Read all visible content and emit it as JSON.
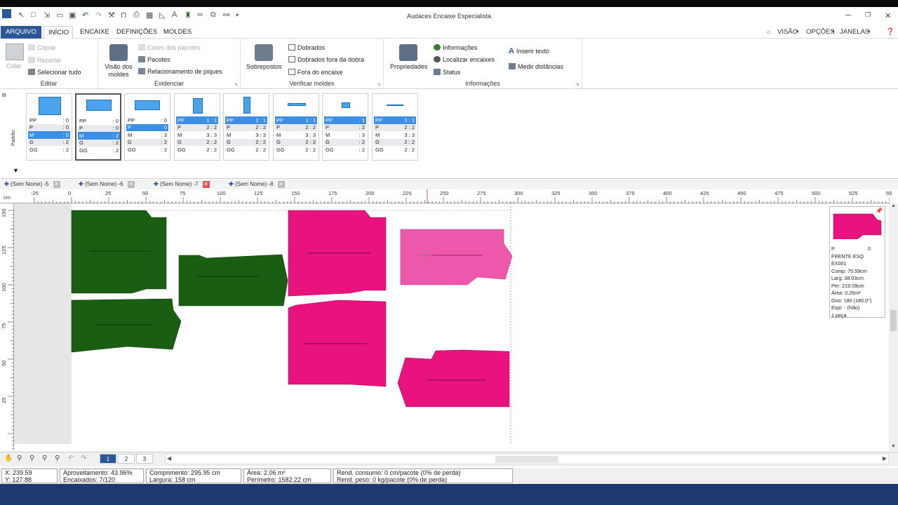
{
  "app": {
    "title": "Audaces Encaixe Especialista"
  },
  "menu": {
    "tabs": [
      "ARQUIVO",
      "INÍCIO",
      "ENCAIXE",
      "DEFINIÇÕES",
      "MOLDES"
    ],
    "right": [
      "VISÃO",
      "OPÇÕES",
      "JANELAS"
    ]
  },
  "ribbon": {
    "editar": {
      "label": "Editar",
      "colar": "Colar",
      "copiar": "Copiar",
      "recortar": "Recortar",
      "selecionar_tudo": "Selecionar tudo"
    },
    "evidenciar": {
      "label": "Evidenciar",
      "visao_dos_moldes": "Visão dos moldes",
      "cores_dos_pacotes": "Cores dos pacotes",
      "pacotes": "Pacotes",
      "relacionamento": "Relacionamento de piques"
    },
    "verificar": {
      "label": "Verificar moldes",
      "sobrepostos": "Sobrepostos",
      "dobrados": "Dobrados",
      "dobrados_fora": "Dobrados fora da dobra",
      "fora_do_encaixe": "Fora do encaixe"
    },
    "informacoes": {
      "label": "Informações",
      "propriedades": "Propriedades",
      "informacoes": "Informações",
      "localizar": "Localizar encaixes",
      "status": "Status",
      "inserir_texto": "Inserir texto",
      "medir": "Medir distâncias"
    }
  },
  "thumbs": {
    "side_label": "Padrão",
    "cards": [
      {
        "rows": [
          [
            "PP",
            ": 0"
          ],
          [
            "P",
            ": 0"
          ],
          [
            "M",
            ": 0"
          ],
          [
            "G",
            ": 2"
          ],
          [
            "GG",
            ": 2"
          ]
        ],
        "hl": 2
      },
      {
        "rows": [
          [
            "PP",
            ": 0"
          ],
          [
            "P",
            ": 0"
          ],
          [
            "M",
            ": 2"
          ],
          [
            "G",
            ": 2"
          ],
          [
            "GG",
            ": 2"
          ]
        ],
        "hl": 2
      },
      {
        "rows": [
          [
            "PP",
            ": 0"
          ],
          [
            "P",
            ": 0"
          ],
          [
            "M",
            ": 3"
          ],
          [
            "G",
            ": 2"
          ],
          [
            "GG",
            ": 2"
          ]
        ],
        "hl": 1
      },
      {
        "rows": [
          [
            "PP",
            "1 : 1"
          ],
          [
            "P",
            "2 : 2"
          ],
          [
            "M",
            "3 : 3"
          ],
          [
            "G",
            "2 : 2"
          ],
          [
            "GG",
            "2 : 2"
          ]
        ],
        "hl": 0
      },
      {
        "rows": [
          [
            "PP",
            "1 : 1"
          ],
          [
            "P",
            "2 : 2"
          ],
          [
            "M",
            "3 : 3"
          ],
          [
            "G",
            "2 : 2"
          ],
          [
            "GG",
            "2 : 2"
          ]
        ],
        "hl": 0
      },
      {
        "rows": [
          [
            "PP",
            "1 : 1"
          ],
          [
            "P",
            "2 : 2"
          ],
          [
            "M",
            "3 : 3"
          ],
          [
            "G",
            "2 : 2"
          ],
          [
            "GG",
            "2 : 2"
          ]
        ],
        "hl": 0
      },
      {
        "rows": [
          [
            "PP",
            ": 1"
          ],
          [
            "P",
            ": 2"
          ],
          [
            "M",
            ": 3"
          ],
          [
            "G",
            ": 2"
          ],
          [
            "GG",
            ": 2"
          ]
        ],
        "hl": 0
      },
      {
        "rows": [
          [
            "PP",
            "1 : 1"
          ],
          [
            "P",
            "2 : 2"
          ],
          [
            "M",
            "3 : 3"
          ],
          [
            "G",
            "2 : 2"
          ],
          [
            "GG",
            "2 : 2"
          ]
        ],
        "hl": 0
      }
    ]
  },
  "doc_tabs": [
    "(Sem Nome) -5",
    "(Sem Nome) -6",
    "(Sem Nome) -7",
    "(Sem Nome) -8"
  ],
  "ruler": {
    "unit": "cm",
    "h_labels": [
      "-25",
      "0",
      "25",
      "50",
      "75",
      "100",
      "125",
      "150",
      "175",
      "200",
      "225",
      "250",
      "275",
      "300",
      "325",
      "350",
      "375",
      "400",
      "425",
      "450",
      "475",
      "500",
      "525",
      "55"
    ],
    "v_labels": [
      "150",
      "125",
      "100",
      "75",
      "50",
      "25"
    ]
  },
  "info_panel": {
    "size": "P",
    "count": "0",
    "name": "FRENTE ESQ",
    "code": "EX001",
    "comp": "Comp: 75.59cm",
    "larg": "Larg: 38.03cm",
    "per": "Per: 219.09cm",
    "area": "Área: 0.26m²",
    "giro": "Giro: 180  (180.0°)",
    "espi": "Espi: -  (Não)",
    "pecas": "1 peça"
  },
  "pages": [
    "1",
    "2",
    "3"
  ],
  "status": {
    "x": "X: 239.59",
    "y": "Y: 127.88",
    "aproveitamento": "Aproveitamento: 43.96%",
    "encaixados": "Encaixados: 7/120",
    "comprimento": "Comprimento: 295.95 cm",
    "largura": "Largura: 158 cm",
    "area": "Área: 2.06 m²",
    "perimetro": "Perímetro: 1582.22 cm",
    "rend_consumo": "Rend. consumo: 0 cm/pacote (0% de perda)",
    "rend_peso": "Rend. peso: 0 kg/pacote (0% de perda)"
  },
  "colors": {
    "accent": "#2b5797",
    "green_piece": "#1a5e14",
    "pink_piece": "#e8137f",
    "pink_light": "#ee58ac",
    "thumb_blue": "#4aa3ec"
  }
}
